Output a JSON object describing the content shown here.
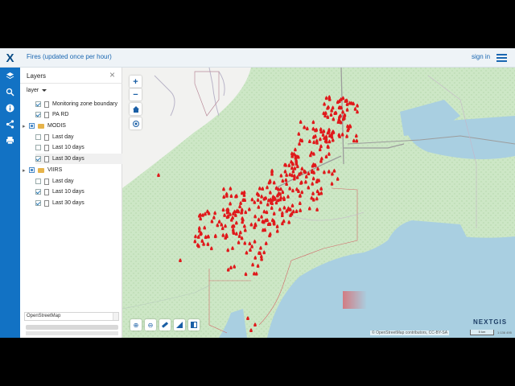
{
  "app": {
    "title": "Fires (updated once per hour)",
    "signin": "sign in",
    "logo": "X"
  },
  "leftbar": [
    "layers-icon",
    "search-icon",
    "info-icon",
    "share-icon",
    "print-icon"
  ],
  "panel": {
    "title": "Layers",
    "select_label": "layer",
    "rows": [
      {
        "label": "Monitoring zone boundary",
        "checked": true,
        "kind": "doc"
      },
      {
        "label": "PA RD",
        "checked": true,
        "kind": "doc"
      },
      {
        "label": "MODIS",
        "checked": "partial",
        "kind": "folder"
      },
      {
        "label": "Last day",
        "checked": false,
        "kind": "doc"
      },
      {
        "label": "Last 10 days",
        "checked": false,
        "kind": "doc"
      },
      {
        "label": "Last 30 days",
        "checked": true,
        "kind": "doc"
      },
      {
        "label": "VIIRS",
        "checked": "partial",
        "kind": "folder"
      },
      {
        "label": "Last day",
        "checked": false,
        "kind": "doc"
      },
      {
        "label": "Last 10 days",
        "checked": true,
        "kind": "doc"
      },
      {
        "label": "Last 30 days",
        "checked": true,
        "kind": "doc"
      }
    ],
    "basemap": "OpenStreetMap"
  },
  "map": {
    "attribution": "© OpenStreetMap contributors, CC-BY-SA",
    "scale_label": "5 km",
    "scale_ratio": "1:136 495",
    "brand": "NEXTGIS",
    "colors": {
      "forest": "#cfe8c8",
      "water": "#aacfe0",
      "fire": "#e0191b"
    }
  }
}
